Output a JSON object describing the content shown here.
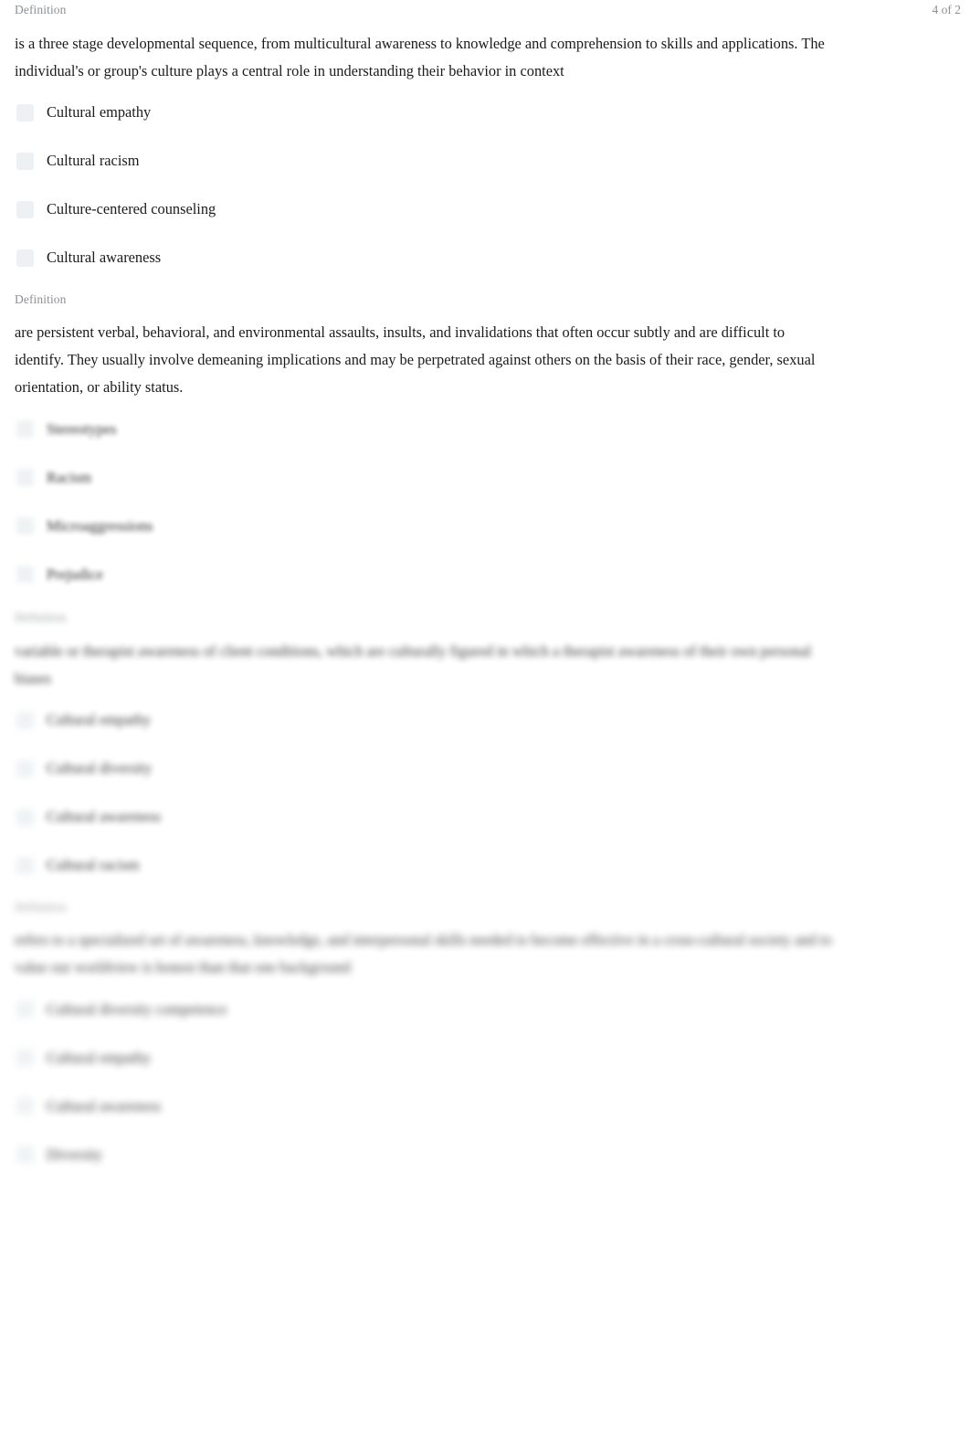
{
  "document": {
    "background_color": "#ffffff",
    "text_color": "#1b1b1d",
    "muted_color": "#8c9094",
    "marker_color": "#edf1f3"
  },
  "header": {
    "counter": "4 of 2"
  },
  "questions": [
    {
      "kind": "Definition",
      "counter": "4 of 2",
      "prompt": "is a three stage developmental sequence, from multicultural awareness to knowledge and comprehension to skills and applications. The individual's or group's culture plays a central role in understanding their behavior in context",
      "options": [
        {
          "label": "Cultural empathy"
        },
        {
          "label": "Cultural racism"
        },
        {
          "label": "Culture-centered counseling"
        },
        {
          "label": "Cultural awareness"
        }
      ]
    },
    {
      "kind": "Definition",
      "counter": "",
      "prompt": "are persistent verbal, behavioral, and environmental assaults, insults, and invalidations that often occur subtly and are difficult to identify. They usually involve demeaning implications and may be perpetrated against others on the basis of their race, gender, sexual orientation, or ability status.",
      "options": [
        {
          "label": "Stereotypes"
        },
        {
          "label": "Racism"
        },
        {
          "label": "Microaggressions"
        },
        {
          "label": "Prejudice"
        }
      ]
    },
    {
      "kind": "Definition",
      "counter": "",
      "prompt": "variable or therapist awareness of client conditions, which are culturally figured in which a therapist awareness of their own personal biases",
      "options": [
        {
          "label": "Cultural empathy"
        },
        {
          "label": "Cultural diversity"
        },
        {
          "label": "Cultural awareness"
        },
        {
          "label": "Cultural racism"
        }
      ]
    },
    {
      "kind": "Definition",
      "counter": "",
      "prompt": "refers to a specialized set of awareness, knowledge, and interpersonal skills needed to become effective in a cross-cultural society and to value our worldview is honest than that one background",
      "options": [
        {
          "label": "Cultural diversity competence"
        },
        {
          "label": "Cultural empathy"
        },
        {
          "label": "Cultural awareness"
        },
        {
          "label": "Diversity"
        }
      ]
    }
  ]
}
